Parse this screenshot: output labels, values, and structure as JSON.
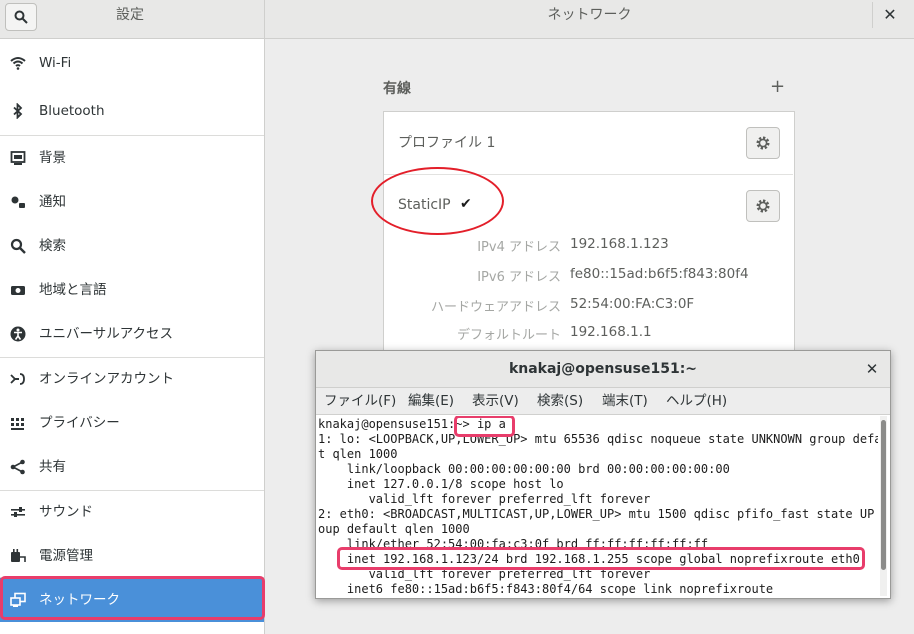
{
  "header": {
    "app_title": "設定",
    "page_title": "ネットワーク",
    "close_glyph": "✕"
  },
  "sidebar": {
    "items": [
      {
        "label": "Wi-Fi",
        "icon": "wifi-icon"
      },
      {
        "label": "Bluetooth",
        "icon": "bluetooth-icon"
      },
      {
        "label": "背景",
        "icon": "background-icon"
      },
      {
        "label": "通知",
        "icon": "notification-icon"
      },
      {
        "label": "検索",
        "icon": "search-icon"
      },
      {
        "label": "地域と言語",
        "icon": "region-icon"
      },
      {
        "label": "ユニバーサルアクセス",
        "icon": "accessibility-icon"
      },
      {
        "label": "オンラインアカウント",
        "icon": "online-accounts-icon"
      },
      {
        "label": "プライバシー",
        "icon": "privacy-icon"
      },
      {
        "label": "共有",
        "icon": "share-icon"
      },
      {
        "label": "サウンド",
        "icon": "sound-icon"
      },
      {
        "label": "電源管理",
        "icon": "power-icon"
      },
      {
        "label": "ネットワーク",
        "icon": "network-icon",
        "selected": true
      }
    ]
  },
  "wired": {
    "section_label": "有線",
    "add_glyph": "+",
    "profiles": [
      {
        "name": "プロファイル 1"
      },
      {
        "name": "StaticIP",
        "active": true,
        "check_glyph": "✔"
      }
    ],
    "details": [
      {
        "key": "IPv4 アドレス",
        "value": "192.168.1.123"
      },
      {
        "key": "IPv6 アドレス",
        "value": "fe80::15ad:b6f5:f843:80f4"
      },
      {
        "key": "ハードウェアアドレス",
        "value": "52:54:00:FA:C3:0F"
      },
      {
        "key": "デフォルトルート",
        "value": "192.168.1.1"
      }
    ]
  },
  "terminal": {
    "title": "knakaj@opensuse151:~",
    "close_glyph": "✕",
    "menu": [
      "ファイル(F)",
      "編集(E)",
      "表示(V)",
      "検索(S)",
      "端末(T)",
      "ヘルプ(H)"
    ],
    "prompt": "knakaj@opensuse151:~> ",
    "command": "ip a",
    "lines": [
      "1: lo: <LOOPBACK,UP,LOWER_UP> mtu 65536 qdisc noqueue state UNKNOWN group defaul",
      "t qlen 1000",
      "    link/loopback 00:00:00:00:00:00 brd 00:00:00:00:00:00",
      "    inet 127.0.0.1/8 scope host lo",
      "       valid_lft forever preferred_lft forever",
      "2: eth0: <BROADCAST,MULTICAST,UP,LOWER_UP> mtu 1500 qdisc pfifo_fast state UP gr",
      "oup default qlen 1000",
      "    link/ether 52:54:00:fa:c3:0f brd ff:ff:ff:ff:ff:ff",
      "    inet 192.168.1.123/24 brd 192.168.1.255 scope global noprefixroute eth0",
      "       valid_lft forever preferred_lft forever",
      "    inet6 fe80::15ad:b6f5:f843:80f4/64 scope link noprefixroute"
    ]
  },
  "colors": {
    "selected_bg": "#4a90d9",
    "highlight_box": "#e83d6b",
    "circle_mark": "#e31f2a"
  }
}
